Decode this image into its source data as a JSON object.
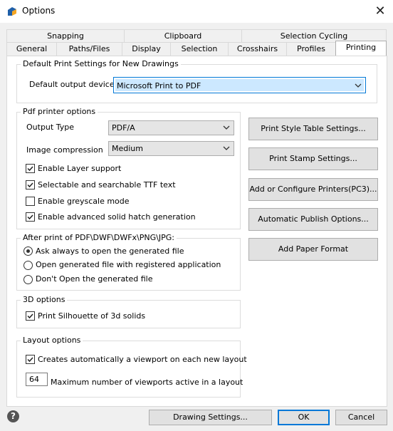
{
  "window": {
    "title": "Options",
    "icon": "app-logo-icon",
    "close_icon": "close-icon"
  },
  "tabs_row1": [
    "Snapping",
    "Clipboard",
    "Selection Cycling"
  ],
  "tabs_row2": [
    "General",
    "Paths/Files",
    "Display",
    "Selection",
    "Crosshairs",
    "Profiles",
    "Printing"
  ],
  "active_tab": "Printing",
  "default_print": {
    "title": "Default Print Settings for New Drawings",
    "output_device_label": "Default output device:",
    "output_device_value": "Microsoft Print to PDF"
  },
  "pdf": {
    "title": "Pdf printer options",
    "output_type_label": "Output Type",
    "output_type_value": "PDF/A",
    "image_compression_label": "Image compression",
    "image_compression_value": "Medium",
    "checkboxes": [
      {
        "label": "Enable Layer support",
        "checked": true
      },
      {
        "label": "Selectable and searchable TTF text",
        "checked": true
      },
      {
        "label": "Enable greyscale mode",
        "checked": false
      },
      {
        "label": "Enable advanced solid hatch generation",
        "checked": true
      }
    ]
  },
  "after_print": {
    "title": "After print of PDF\\DWF\\DWFx\\PNG\\JPG:",
    "options": [
      {
        "label": "Ask always to open the generated file",
        "selected": true
      },
      {
        "label": "Open generated file with registered application",
        "selected": false
      },
      {
        "label": "Don't Open the generated file",
        "selected": false
      }
    ]
  },
  "three_d": {
    "title": "3D options",
    "checkbox": {
      "label": "Print Silhouette of 3d solids",
      "checked": true
    }
  },
  "layout": {
    "title": "Layout options",
    "checkbox": {
      "label": "Creates automatically a viewport on each new layout",
      "checked": true
    },
    "max_viewports_value": "64",
    "max_viewports_label": "Maximum number of viewports active in a layout"
  },
  "side_buttons": [
    "Print Style Table Settings...",
    "Print Stamp Settings...",
    "Add or Configure Printers(PC3)...",
    "Automatic Publish Options...",
    "Add Paper Format"
  ],
  "footer": {
    "drawing_settings": "Drawing Settings...",
    "ok": "OK",
    "cancel": "Cancel",
    "help_glyph": "?"
  },
  "colors": {
    "accent": "#0078d7",
    "selection": "#cce8ff"
  }
}
